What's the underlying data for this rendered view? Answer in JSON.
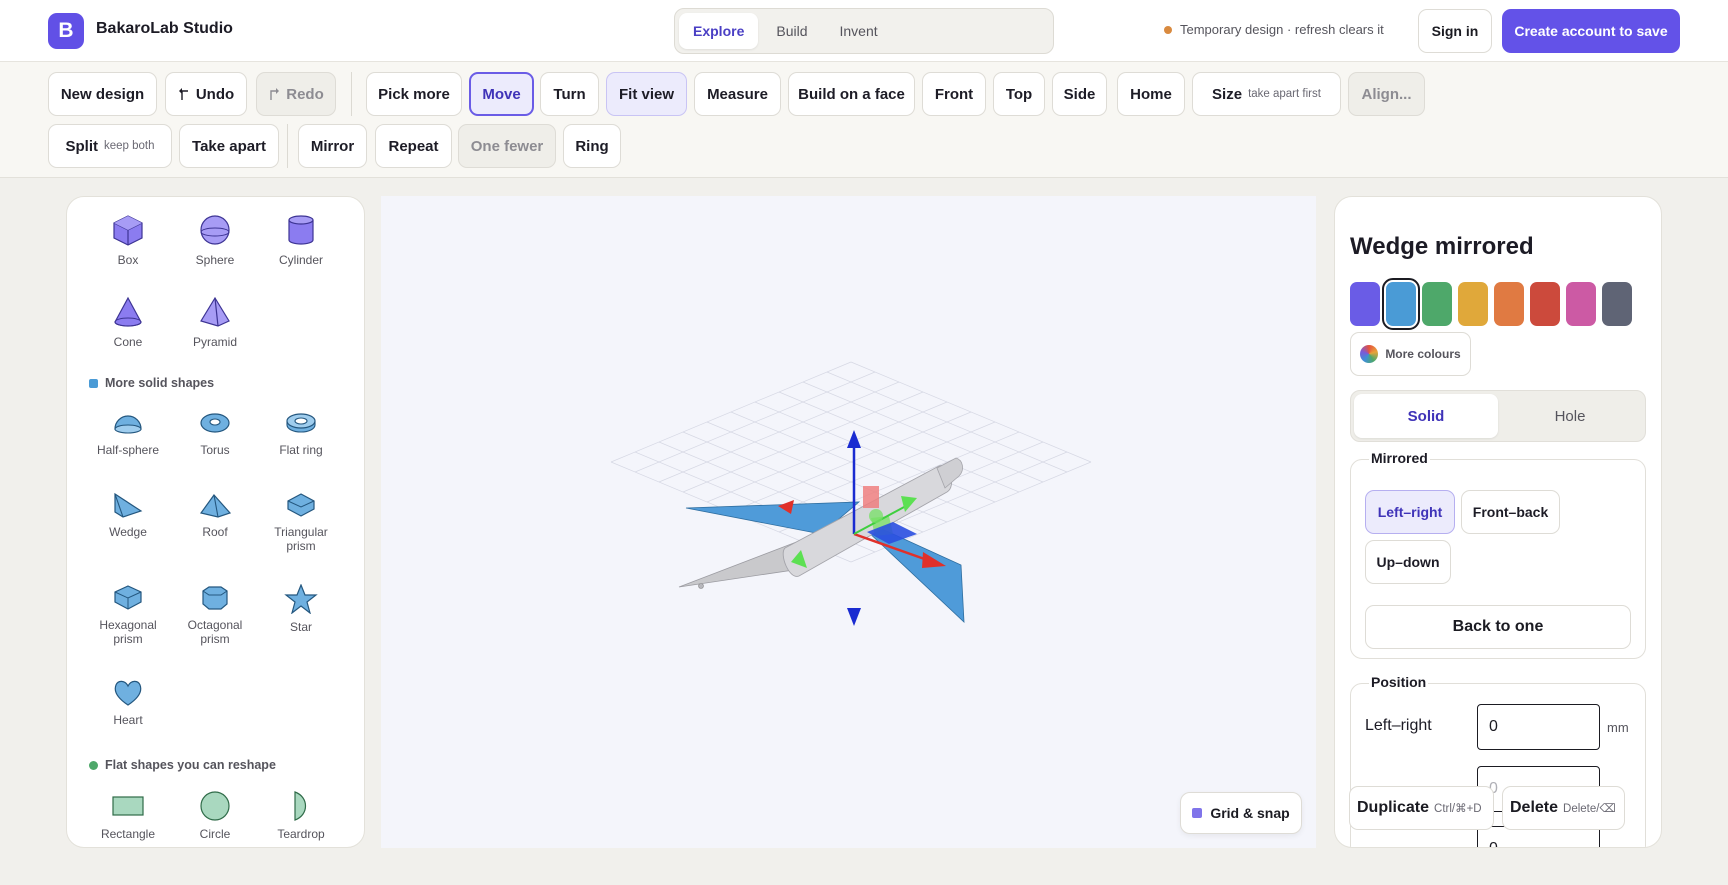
{
  "app": {
    "logo_letter": "B",
    "title": "BakaroLab Studio"
  },
  "mode_tabs": [
    "Explore",
    "Build",
    "Invent"
  ],
  "active_mode": "Explore",
  "header": {
    "temp_note": "Temporary design · refresh clears it",
    "sign_in": "Sign in",
    "create_account": "Create account to save"
  },
  "toolbar": {
    "row1": {
      "new_design": "New design",
      "undo": "Undo",
      "redo": "Redo",
      "pick_more": "Pick more",
      "move": "Move",
      "turn": "Turn",
      "fit_view": "Fit view",
      "measure": "Measure",
      "build_on_face": "Build on a face",
      "front": "Front",
      "top": "Top",
      "side": "Side",
      "home": "Home",
      "size": "Size",
      "size_hint": "take apart first",
      "align": "Align..."
    },
    "row2": {
      "split": "Split",
      "split_hint": "keep both",
      "take_apart": "Take apart",
      "mirror": "Mirror",
      "repeat": "Repeat",
      "one_fewer": "One fewer",
      "ring": "Ring"
    },
    "undo_icon": "undo-arrow-icon",
    "redo_icon": "redo-arrow-icon"
  },
  "shapes": {
    "basic": [
      "Box",
      "Sphere",
      "Cylinder",
      "Cone",
      "Pyramid"
    ],
    "more_heading": "More solid shapes",
    "more": [
      "Half-sphere",
      "Torus",
      "Flat ring",
      "Wedge",
      "Roof",
      "Triangular prism",
      "Hexagonal prism",
      "Octagonal prism",
      "Star",
      "Heart"
    ],
    "flat_heading": "Flat shapes you can reshape",
    "flat": [
      "Rectangle",
      "Circle",
      "Teardrop"
    ],
    "colors": {
      "basic": "#8b7cf0",
      "more": "#6fb0e0",
      "flat": "#a9d8bf",
      "more_dot": "#4a9bd6",
      "flat_dot": "#4ea86a"
    }
  },
  "viewport": {
    "grid_snap": "Grid & snap"
  },
  "props": {
    "title": "Wedge mirrored",
    "swatches": [
      "#6a5ce6",
      "#4a9bd6",
      "#4ea86a",
      "#e0a83a",
      "#e07a42",
      "#cc4a3c",
      "#cc5aa4",
      "#5f6475"
    ],
    "selected_swatch": 1,
    "more_colours": "More colours",
    "solid": "Solid",
    "hole": "Hole",
    "mirrored_legend": "Mirrored",
    "left_right": "Left–right",
    "front_back": "Front–back",
    "up_down": "Up–down",
    "back_to_one": "Back to one",
    "position_legend": "Position",
    "pos_left_right": "Left–right",
    "pos_left_right_value": "0",
    "unit": "mm",
    "pos_front_back_value": "0",
    "pos_up_down_value": "0",
    "duplicate": "Duplicate",
    "duplicate_key": "Ctrl/⌘+D",
    "delete": "Delete",
    "delete_key": "Delete/⌫"
  }
}
